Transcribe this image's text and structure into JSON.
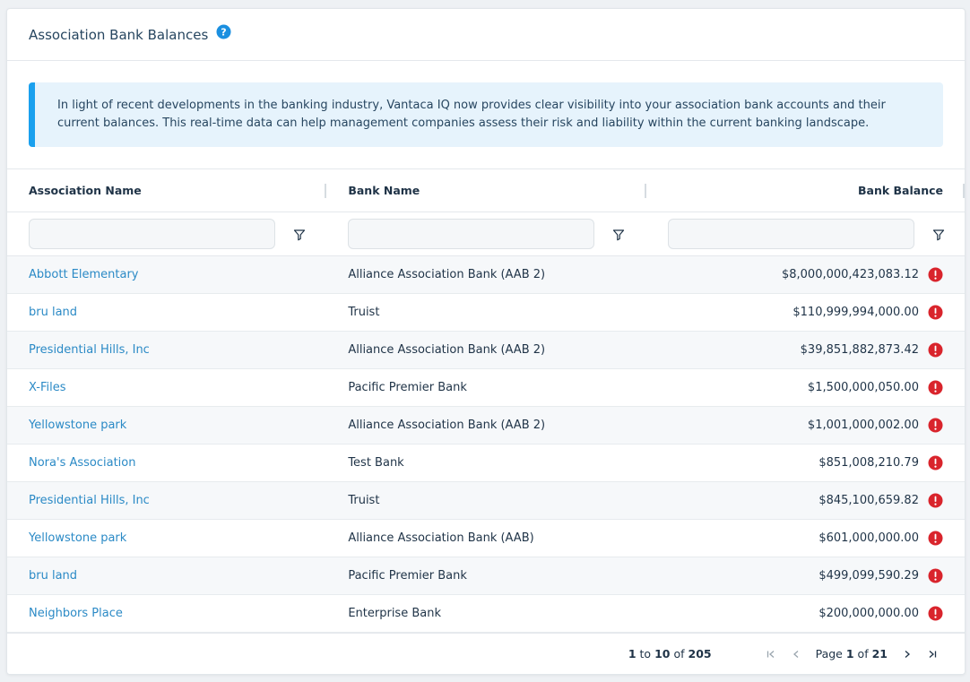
{
  "header": {
    "title": "Association Bank Balances"
  },
  "banner": {
    "text": "In light of recent developments in the banking industry, Vantaca IQ now provides clear visibility into your association bank accounts and their current balances. This real-time data can help management companies assess their risk and liability within the current banking landscape."
  },
  "columns": {
    "association": "Association Name",
    "bank": "Bank Name",
    "balance": "Bank Balance"
  },
  "filters": {
    "association_value": "",
    "bank_value": "",
    "balance_value": ""
  },
  "rows": [
    {
      "association": "Abbott Elementary",
      "bank": "Alliance Association Bank (AAB 2)",
      "balance": "$8,000,000,423,083.12"
    },
    {
      "association": "bru land",
      "bank": "Truist",
      "balance": "$110,999,994,000.00"
    },
    {
      "association": "Presidential Hills, Inc",
      "bank": "Alliance Association Bank (AAB 2)",
      "balance": "$39,851,882,873.42"
    },
    {
      "association": "X-Files",
      "bank": "Pacific Premier Bank",
      "balance": "$1,500,000,050.00"
    },
    {
      "association": "Yellowstone park",
      "bank": "Alliance Association Bank (AAB 2)",
      "balance": "$1,001,000,002.00"
    },
    {
      "association": "Nora's Association",
      "bank": "Test Bank",
      "balance": "$851,008,210.79"
    },
    {
      "association": "Presidential Hills, Inc",
      "bank": "Truist",
      "balance": "$845,100,659.82"
    },
    {
      "association": "Yellowstone park",
      "bank": "Alliance Association Bank (AAB)",
      "balance": "$601,000,000.00"
    },
    {
      "association": "bru land",
      "bank": "Pacific Premier Bank",
      "balance": "$499,099,590.29"
    },
    {
      "association": "Neighbors Place",
      "bank": "Enterprise Bank",
      "balance": "$200,000,000.00"
    }
  ],
  "pagination": {
    "from": "1",
    "to_word": "to",
    "to": "10",
    "of_word": "of",
    "total": "205",
    "page_word": "Page",
    "page": "1",
    "page_of_word": "of",
    "pages": "21"
  },
  "icons": {
    "help": "help-circle-icon",
    "filter": "filter-icon",
    "warning": "warning-circle-icon",
    "first": "first-page-icon",
    "prev": "previous-page-icon",
    "next": "next-page-icon",
    "last": "last-page-icon"
  },
  "colors": {
    "accent": "#1aa0ee",
    "link": "#2b8ac6",
    "warning": "#d9242c",
    "banner_bg": "#e6f3fc"
  }
}
